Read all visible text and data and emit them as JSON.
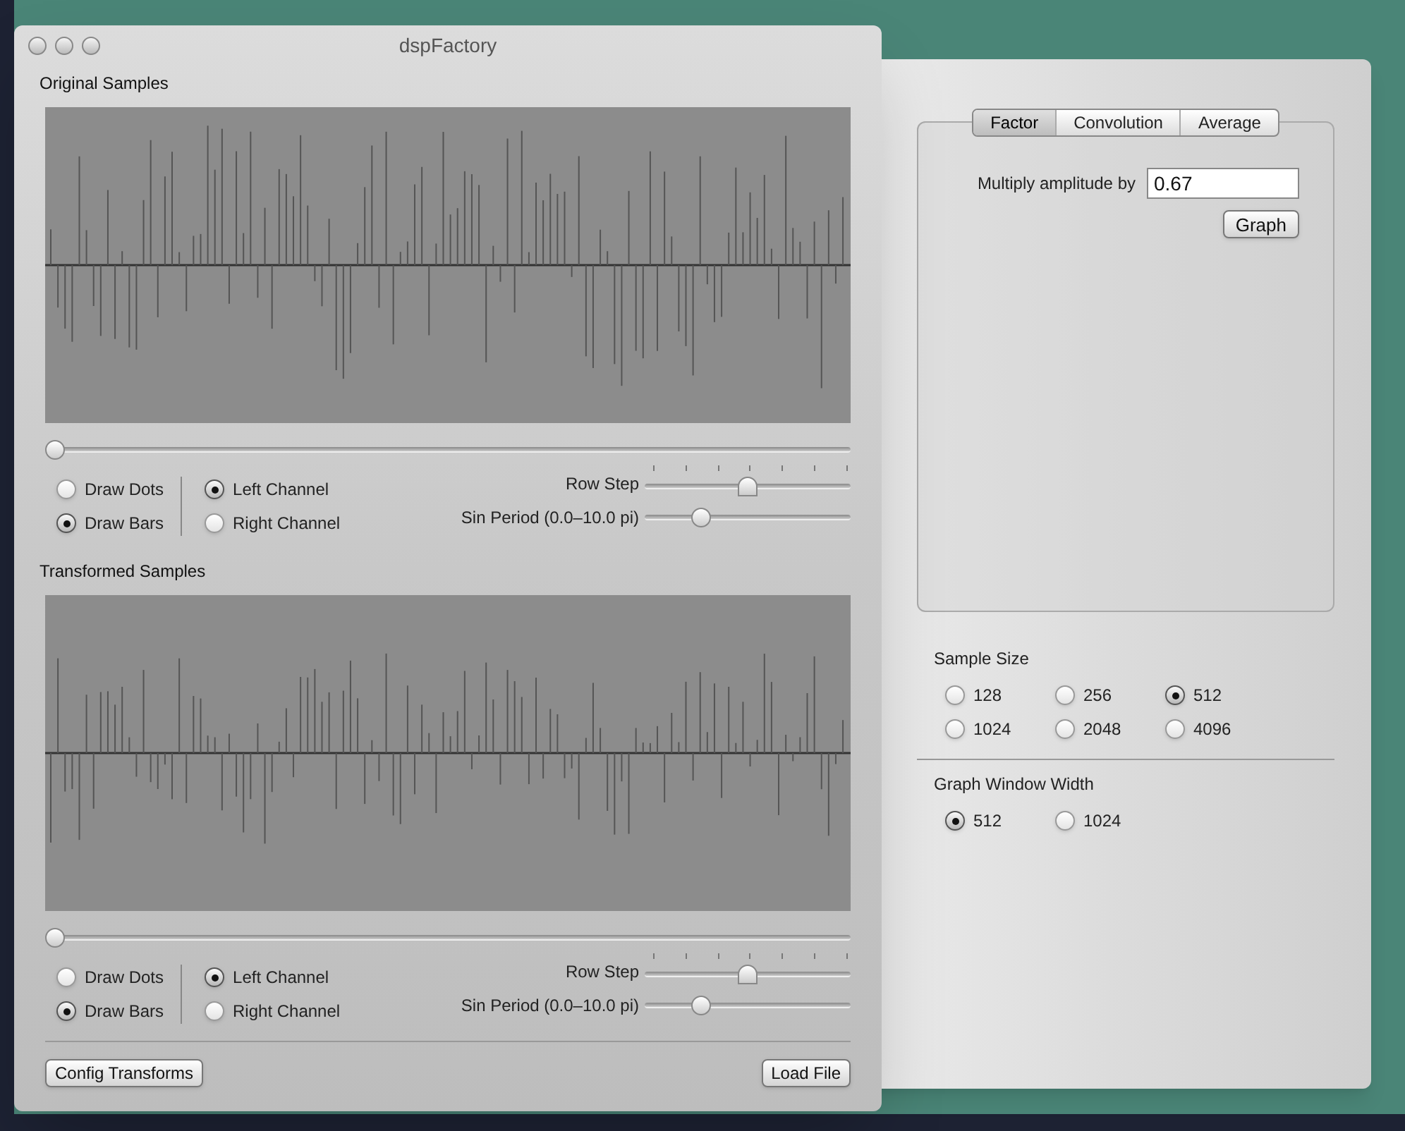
{
  "window": {
    "title": "dspFactory"
  },
  "panels": [
    {
      "title": "Original Samples",
      "position": {
        "level": 0
      },
      "draw_mode": [
        {
          "label": "Draw Dots",
          "selected": false
        },
        {
          "label": "Draw Bars",
          "selected": true
        }
      ],
      "channel": [
        {
          "label": "Left Channel",
          "selected": true
        },
        {
          "label": "Right Channel",
          "selected": false
        }
      ],
      "row_step": {
        "label": "Row Step",
        "level": 0.5
      },
      "sin_period": {
        "label": "Sin Period (0.0–10.0 pi)",
        "level": 0.25
      }
    },
    {
      "title": "Transformed Samples",
      "position": {
        "level": 0
      },
      "draw_mode": [
        {
          "label": "Draw Dots",
          "selected": false
        },
        {
          "label": "Draw Bars",
          "selected": true
        }
      ],
      "channel": [
        {
          "label": "Left Channel",
          "selected": true
        },
        {
          "label": "Right Channel",
          "selected": false
        }
      ],
      "row_step": {
        "label": "Row Step",
        "level": 0.5
      },
      "sin_period": {
        "label": "Sin Period (0.0–10.0 pi)",
        "level": 0.25
      }
    }
  ],
  "buttons": {
    "config": "Config Transforms",
    "load": "Load File"
  },
  "drawer": {
    "tabs": [
      {
        "label": "Factor",
        "selected": true
      },
      {
        "label": "Convolution",
        "selected": false
      },
      {
        "label": "Average",
        "selected": false
      }
    ],
    "factor_label": "Multiply amplitude by",
    "factor_value": "0.67",
    "graph_button": "Graph",
    "sample_size": {
      "title": "Sample Size",
      "options": [
        {
          "label": "128",
          "selected": false
        },
        {
          "label": "256",
          "selected": false
        },
        {
          "label": "512",
          "selected": true
        },
        {
          "label": "1024",
          "selected": false
        },
        {
          "label": "2048",
          "selected": false
        },
        {
          "label": "4096",
          "selected": false
        }
      ]
    },
    "graph_window_width": {
      "title": "Graph Window Width",
      "options": [
        {
          "label": "512",
          "selected": true
        },
        {
          "label": "1024",
          "selected": false
        }
      ]
    }
  }
}
